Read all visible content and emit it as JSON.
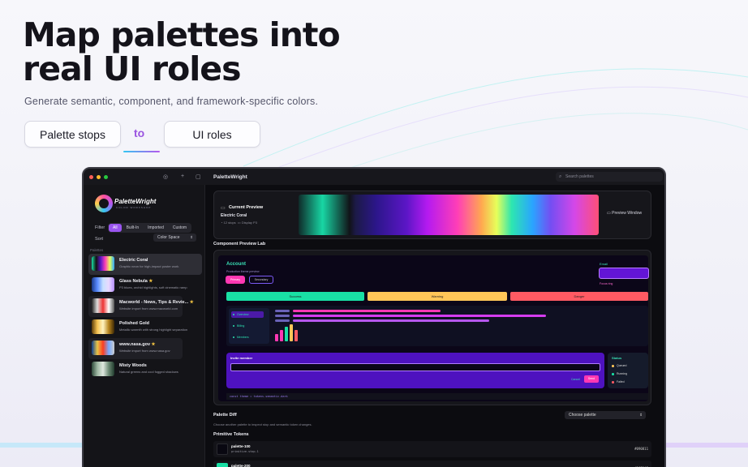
{
  "hero": {
    "title": "Map palettes into real UI roles",
    "subtitle": "Generate semantic, component, and framework-specific colors.",
    "from_label": "Palette stops",
    "connector": "to",
    "to_label": "UI roles"
  },
  "colors": {
    "accent_purple": "#9a55f0",
    "accent_pink": "#ff38b3",
    "accent_teal": "#39e0b6"
  },
  "app": {
    "title": "PaletteWright",
    "search_placeholder": "Search palettes",
    "toolbar_icons": [
      "check-circle-icon",
      "plus-icon",
      "sidebar-toggle-icon"
    ]
  },
  "sidebar": {
    "brand": "PaletteWright",
    "brand_tagline": "COLOR WORKSHOP",
    "filter_label": "Filter",
    "filters": [
      "All",
      "Built-In",
      "Imported",
      "Custom"
    ],
    "sort_label": "Sort",
    "sort_value": "Color Space",
    "section_label": "Palettes",
    "palettes": [
      {
        "name": "Electric Coral",
        "desc": "Graphic neon for high-impact poster work",
        "star": false
      },
      {
        "name": "Glass Nebula",
        "desc": "P3 blues, orchid highlights, soft cinematic ramp",
        "star": true
      },
      {
        "name": "Macworld - News, Tips & Revie...",
        "desc": "Website import from www.macworld.com",
        "star": true
      },
      {
        "name": "Polished Gold",
        "desc": "Metallic warmth with strong highlight separation",
        "star": false
      },
      {
        "name": "www.nasa.gov",
        "desc": "Website import from www.nasa.gov",
        "star": true
      },
      {
        "name": "Misty Woods",
        "desc": "Natural greens and cool fogged shadows",
        "star": false
      }
    ]
  },
  "preview": {
    "title": "Current Preview",
    "palette_name": "Electric Coral",
    "stops": "12 stops",
    "color_space": "Display P3",
    "window_button": "Preview Window"
  },
  "lab": {
    "title": "Component Preview Lab",
    "account_title": "Account",
    "account_subtitle": "Production theme preview",
    "primary_label": "Primary",
    "secondary_label": "Secondary",
    "email_label": "Email",
    "focus_label": "Focus ring",
    "status_buttons": [
      "Success",
      "Warning",
      "Danger"
    ],
    "nav_items": [
      "Overview",
      "Billing",
      "Members"
    ],
    "invite_label": "Invite member",
    "cancel_label": "Cancel",
    "send_label": "Send",
    "status_title": "Status",
    "status_items": [
      "Queued",
      "Running",
      "Failed"
    ],
    "code_line": "const theme = tokens.semantic.dark"
  },
  "diff": {
    "title": "Palette Diff",
    "subtitle": "Choose another palette to inspect stop and semantic token changes.",
    "select_value": "Choose palette"
  },
  "tokens": {
    "title": "Primitive Tokens",
    "items": [
      {
        "name": "palette-100",
        "sub": "primitive.stop.1",
        "hex": "#090811"
      },
      {
        "name": "palette-200",
        "sub": "",
        "hex": "#19E0A5"
      }
    ]
  }
}
